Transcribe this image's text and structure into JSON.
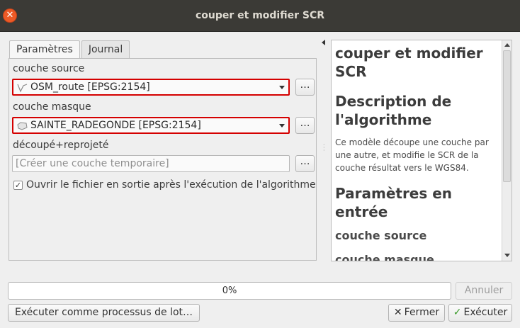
{
  "window": {
    "title": "couper et modifier SCR",
    "close_symbol": "✕"
  },
  "tabs": [
    {
      "label": "Paramètres",
      "active": true
    },
    {
      "label": "Journal",
      "active": false
    }
  ],
  "form": {
    "source_label": "couche source",
    "source_value": "OSM_route [EPSG:2154]",
    "mask_label": "couche masque",
    "mask_value": "SAINTE_RADEGONDE [EPSG:2154]",
    "output_label": "découpé+reprojeté",
    "output_placeholder": "[Créer une couche temporaire]",
    "browse_label": "…",
    "open_after_checked": true,
    "open_after_label": "Ouvrir le fichier en sortie après l'exécution de l'algorithme",
    "check_mark": "✓"
  },
  "help": {
    "title": "couper et modifier SCR",
    "description_heading": "Description de l'algorithme",
    "description_text": "Ce modèle découpe une couche par une autre, et modifie le SCR de la couche résultat vers le WGS84.",
    "inputs_heading": "Paramètres en entrée",
    "input_1": "couche source",
    "input_2": "couche masque"
  },
  "progress": {
    "value": 0,
    "text": "0%"
  },
  "buttons": {
    "cancel": "Annuler",
    "batch": "Exécuter comme processus de lot…",
    "close": "Fermer",
    "run": "Exécuter"
  },
  "colors": {
    "titlebar": "#3b3a36",
    "close_button": "#ee5a26",
    "highlight_border": "#d40000",
    "run_icon": "#3a9a2a"
  },
  "icons": {
    "source_layer": "line-layer-icon",
    "mask_layer": "polygon-layer-icon",
    "close_button": "close-x-icon",
    "run_button": "checkmark-icon"
  }
}
